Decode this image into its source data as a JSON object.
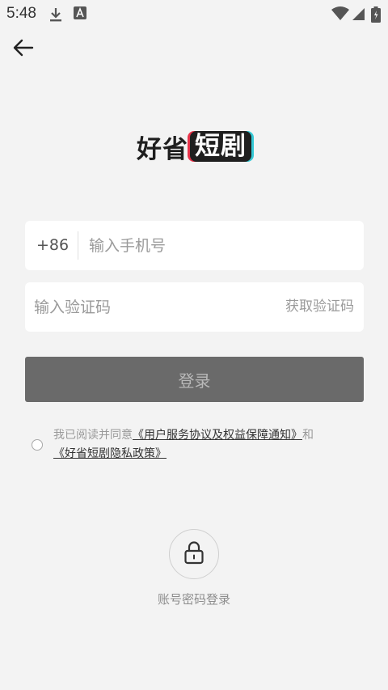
{
  "status_bar": {
    "time": "5:48",
    "icons": [
      "download-icon",
      "font-badge-icon",
      "wifi-icon",
      "signal-icon",
      "battery-icon"
    ]
  },
  "header": {
    "back_icon": "arrow-left-icon"
  },
  "logo": {
    "plain": "好省",
    "boxed": "短剧"
  },
  "phone_field": {
    "country_code": "+86",
    "placeholder": "输入手机号",
    "value": ""
  },
  "code_field": {
    "placeholder": "输入验证码",
    "value": "",
    "get_code_label": "获取验证码"
  },
  "login_button": {
    "label": "登录"
  },
  "agreement": {
    "prefix": "我已阅读并同意",
    "user_agreement": "《用户服务协议及权益保障通知》",
    "connector": "和",
    "privacy_policy": "《好省短剧隐私政策》",
    "checked": false
  },
  "password_login": {
    "icon": "lock-icon",
    "label": "账号密码登录"
  },
  "colors": {
    "background": "#f3f3f3",
    "login_button": "#6a6a6a",
    "logo_red": "#e8334a",
    "logo_cyan": "#35c9d6"
  }
}
